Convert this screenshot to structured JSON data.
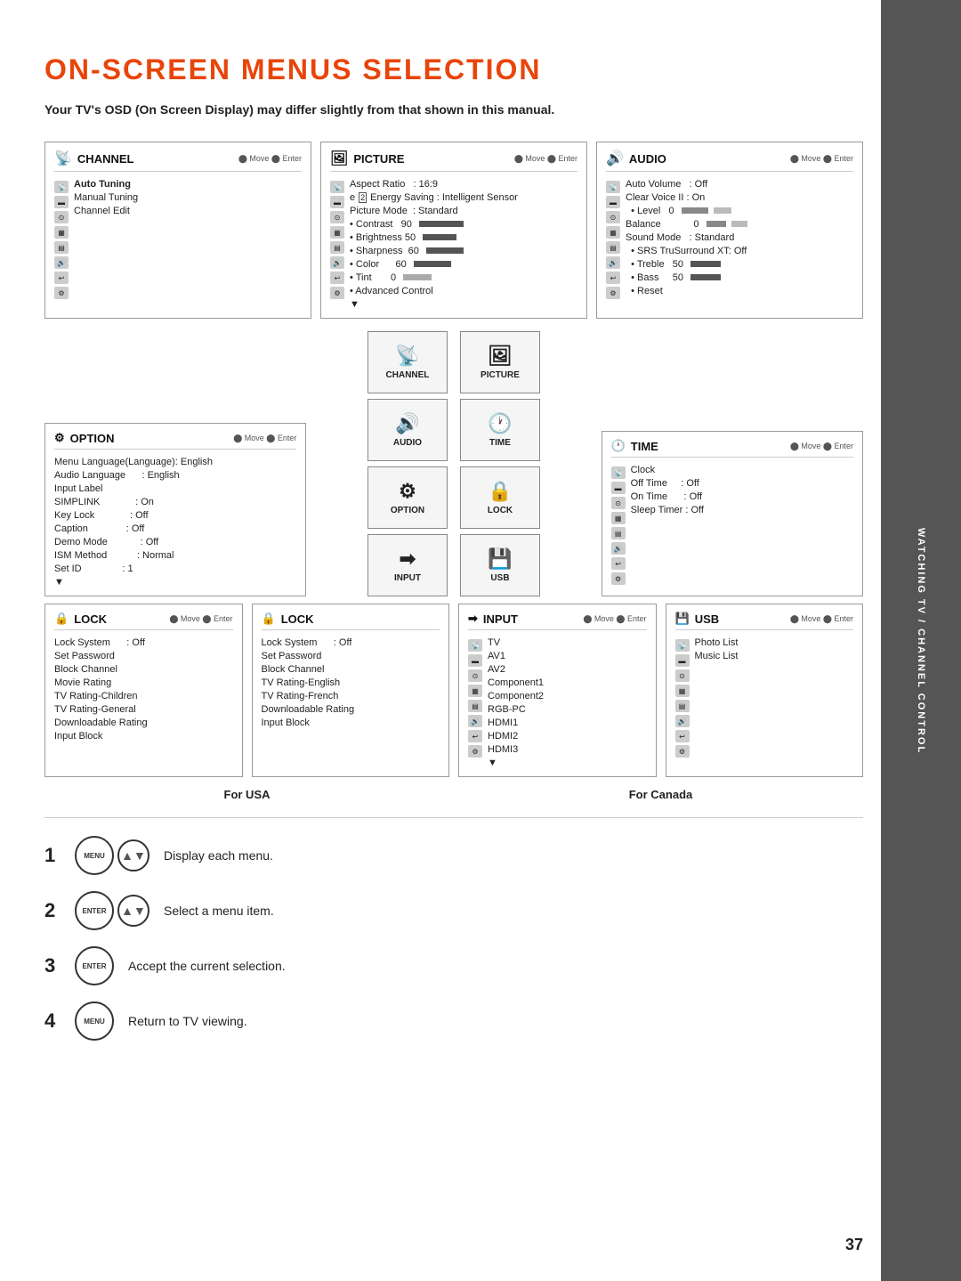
{
  "page": {
    "title": "ON-SCREEN MENUS SELECTION",
    "subtitle": "Your TV's OSD (On Screen Display) may differ slightly from that shown in this manual.",
    "page_number": "37",
    "side_label": "WATCHING TV / CHANNEL CONTROL"
  },
  "menus": {
    "channel": {
      "title": "CHANNEL",
      "move_enter": "Move  Enter",
      "items": [
        {
          "label": "Auto Tuning",
          "indent": false
        },
        {
          "label": "Manual Tuning",
          "indent": false
        },
        {
          "label": "Channel Edit",
          "indent": false
        }
      ]
    },
    "picture": {
      "title": "PICTURE",
      "move_enter": "Move  Enter",
      "items": [
        {
          "label": "Aspect Ratio   : 16:9"
        },
        {
          "label": "eEnergy Saving : Intelligent Sensor"
        },
        {
          "label": "Picture Mode   : Standard"
        },
        {
          "label": "• Contrast  90",
          "bar": 70
        },
        {
          "label": "• Brightness 50",
          "bar": 50
        },
        {
          "label": "• Sharpness  60",
          "bar": 55
        },
        {
          "label": "• Color     60",
          "bar": 55
        },
        {
          "label": "• Tint       0",
          "bar_center": true
        },
        {
          "label": "• Advanced Control"
        }
      ]
    },
    "audio": {
      "title": "AUDIO",
      "move_enter": "Move  Enter",
      "items": [
        {
          "label": "Auto Volume   : Off"
        },
        {
          "label": "Clear Voice II : On"
        },
        {
          "label": "  • Level   0",
          "bar_small": true
        },
        {
          "label": "Balance",
          "bar_center": true,
          "value": "0"
        },
        {
          "label": "Sound Mode    : Standard"
        },
        {
          "label": "  • SRS TruSurround XT: Off"
        },
        {
          "label": "  • Treble    50",
          "bar": 50
        },
        {
          "label": "  • Bass      50",
          "bar": 50
        },
        {
          "label": "  • Reset"
        }
      ]
    },
    "option": {
      "title": "OPTION",
      "move_enter": "Move  Enter",
      "items": [
        {
          "label": "Menu Language(Language): English"
        },
        {
          "label": "Audio Language     : English"
        },
        {
          "label": "Input Label"
        },
        {
          "label": "SIMPLINK          : On"
        },
        {
          "label": "Key Lock          : Off"
        },
        {
          "label": "Caption           : Off"
        },
        {
          "label": "Demo Mode         : Off"
        },
        {
          "label": "ISM Method        : Normal"
        },
        {
          "label": "Set ID            : 1"
        },
        {
          "label": "▼"
        }
      ]
    },
    "time": {
      "title": "TIME",
      "move_enter": "Move  Enter",
      "items": [
        {
          "label": "Clock"
        },
        {
          "label": "Off Time      : Off"
        },
        {
          "label": "On Time       : Off"
        },
        {
          "label": "Sleep Timer   : Off"
        }
      ]
    },
    "lock_usa": {
      "title": "LOCK",
      "move_enter": "Move  Enter",
      "items": [
        {
          "label": "Lock System      : Off"
        },
        {
          "label": "Set Password"
        },
        {
          "label": "Block Channel"
        },
        {
          "label": "Movie Rating"
        },
        {
          "label": "TV Rating-Children"
        },
        {
          "label": "TV Rating-General"
        },
        {
          "label": "Downloadable Rating"
        },
        {
          "label": "Input Block"
        }
      ],
      "footer": "For USA"
    },
    "lock_canada": {
      "title": "LOCK (Canada)",
      "items": [
        {
          "label": "Lock System      : Off"
        },
        {
          "label": "Set Password"
        },
        {
          "label": "Block Channel"
        },
        {
          "label": "TV Rating-English"
        },
        {
          "label": "TV Rating-French"
        },
        {
          "label": "Downloadable Rating"
        },
        {
          "label": "Input Block"
        }
      ],
      "footer": "For Canada"
    },
    "input": {
      "title": "INPUT",
      "move_enter": "Move  Enter",
      "items": [
        {
          "label": "TV"
        },
        {
          "label": "AV1"
        },
        {
          "label": "AV2"
        },
        {
          "label": "Component1"
        },
        {
          "label": "Component2"
        },
        {
          "label": "RGB-PC"
        },
        {
          "label": "HDMI1"
        },
        {
          "label": "HDMI2"
        },
        {
          "label": "HDMI3"
        },
        {
          "label": "▼"
        }
      ]
    },
    "usb": {
      "title": "USB",
      "move_enter": "Move  Enter",
      "items": [
        {
          "label": "Photo List"
        },
        {
          "label": "Music List"
        }
      ]
    }
  },
  "center_thumbs": [
    {
      "label": "CHANNEL",
      "icon": "📺"
    },
    {
      "label": "PICTURE",
      "icon": "🖼"
    },
    {
      "label": "AUDIO",
      "icon": "🔊"
    },
    {
      "label": "TIME",
      "icon": "🕐"
    }
  ],
  "bottom_thumbs": [
    {
      "label": "OPTION",
      "icon": "⚙"
    },
    {
      "label": "LOCK",
      "icon": "🔒"
    },
    {
      "label": "INPUT",
      "icon": "➡"
    },
    {
      "label": "USB",
      "icon": "💾"
    }
  ],
  "steps": [
    {
      "number": "1",
      "btn_label": "MENU",
      "description": "Display each menu."
    },
    {
      "number": "2",
      "btn_label": "ENTER",
      "description": "Select a menu item."
    },
    {
      "number": "3",
      "btn_label": "ENTER",
      "description": "Accept the current selection."
    },
    {
      "number": "4",
      "btn_label": "MENU",
      "description": "Return to TV viewing."
    }
  ]
}
